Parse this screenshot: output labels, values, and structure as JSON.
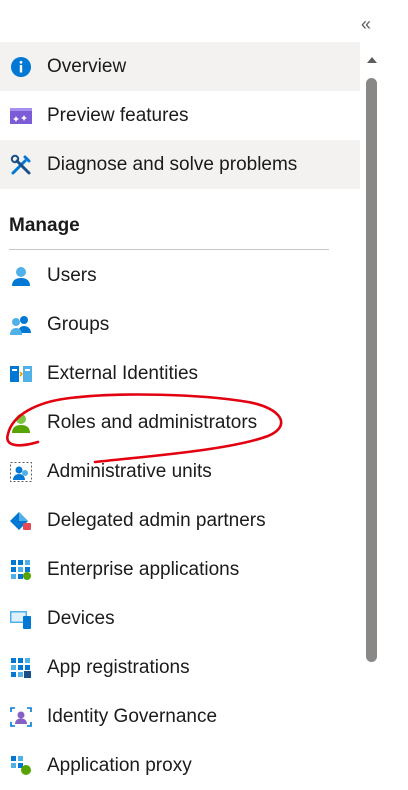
{
  "header": {
    "collapse_icon": "double-chevron-left-icon",
    "collapse_glyph": "«"
  },
  "top_items": [
    {
      "label": "Overview",
      "icon": "info-icon"
    },
    {
      "label": "Preview features",
      "icon": "preview-features-icon"
    },
    {
      "label": "Diagnose and solve problems",
      "icon": "wrench-screwdriver-icon"
    }
  ],
  "manage": {
    "title": "Manage",
    "items": [
      {
        "label": "Users",
        "icon": "user-icon"
      },
      {
        "label": "Groups",
        "icon": "groups-icon"
      },
      {
        "label": "External Identities",
        "icon": "external-identities-icon"
      },
      {
        "label": "Roles and administrators",
        "icon": "roles-icon"
      },
      {
        "label": "Administrative units",
        "icon": "administrative-units-icon"
      },
      {
        "label": "Delegated admin partners",
        "icon": "delegated-partners-icon"
      },
      {
        "label": "Enterprise applications",
        "icon": "enterprise-apps-icon"
      },
      {
        "label": "Devices",
        "icon": "devices-icon"
      },
      {
        "label": "App registrations",
        "icon": "app-registrations-icon"
      },
      {
        "label": "Identity Governance",
        "icon": "identity-governance-icon"
      },
      {
        "label": "Application proxy",
        "icon": "application-proxy-icon"
      }
    ]
  },
  "colors": {
    "selected_bg": "#f3f2f1",
    "annotation_red": "#e3000f",
    "azure_blue": "#0078d4"
  }
}
